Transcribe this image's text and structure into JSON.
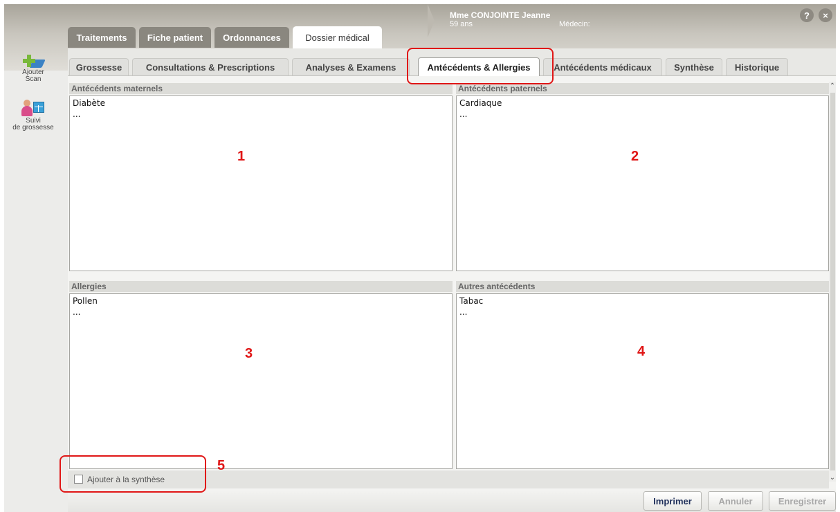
{
  "header": {
    "patient_name": "Mme CONJOINTE Jeanne",
    "patient_age": "59 ans",
    "medecin_label": "Médecin:",
    "help_glyph": "?",
    "close_glyph": "×"
  },
  "main_tabs": [
    {
      "label": "Traitements",
      "active": false
    },
    {
      "label": "Fiche patient",
      "active": false
    },
    {
      "label": "Ordonnances",
      "active": false
    },
    {
      "label": "Dossier médical",
      "active": true
    }
  ],
  "toolbar": [
    {
      "label_lines": [
        "Ajouter",
        "Scan"
      ],
      "icon": "add-scan-icon"
    },
    {
      "label_lines": [
        "Suivi",
        "de grossesse"
      ],
      "icon": "pregnancy-tracking-icon"
    }
  ],
  "sub_tabs": [
    {
      "label": "Grossesse",
      "active": false
    },
    {
      "label": "Consultations & Prescriptions",
      "active": false
    },
    {
      "label": "Analyses & Examens",
      "active": false
    },
    {
      "label": "Antécédents & Allergies",
      "active": true
    },
    {
      "label": "Antécédents médicaux",
      "active": false
    },
    {
      "label": "Synthèse",
      "active": false
    },
    {
      "label": "Historique",
      "active": false
    }
  ],
  "panels": [
    {
      "title": "Antécédents maternels",
      "lines": [
        "Diabète",
        "..."
      ]
    },
    {
      "title": "Antécédents paternels",
      "lines": [
        "Cardiaque",
        "..."
      ]
    },
    {
      "title": "Allergies",
      "lines": [
        "Pollen",
        "..."
      ]
    },
    {
      "title": "Autres antécédents",
      "lines": [
        "Tabac",
        "..."
      ]
    }
  ],
  "checkbox": {
    "label": "Ajouter à la synthèse",
    "checked": false
  },
  "actions": {
    "print": "Imprimer",
    "cancel": "Annuler",
    "save": "Enregistrer"
  },
  "annotations": [
    "1",
    "2",
    "3",
    "4",
    "5"
  ],
  "colors": {
    "annotation": "#e01616",
    "active_tab": "#ffffff",
    "inactive_main_tab": "#8a877f"
  }
}
